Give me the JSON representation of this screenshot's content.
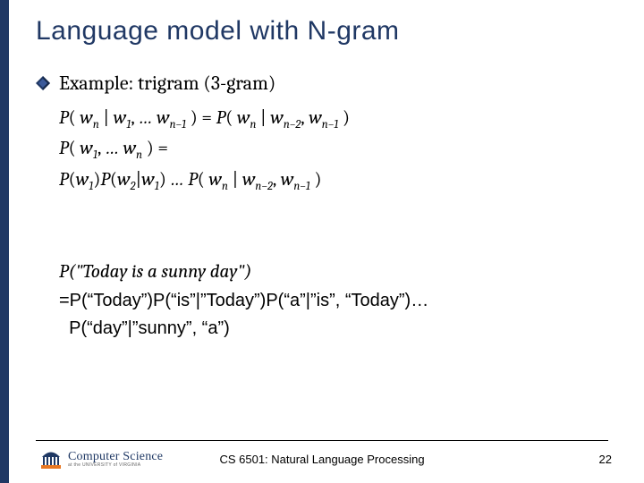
{
  "title": "Language model with N-gram",
  "bullet_icon_name": "diamond-bullet-icon",
  "example_label": "Example: trigram (3-gram)",
  "eq1_lhs": "P( w<sub>n</sub> | w<sub>1</sub>, … w<sub>n−1</sub> )",
  "eq1_rhs": "= P( w<sub>n</sub> | w<sub>n−2</sub>, w<sub>n−1</sub> )",
  "eq2_lhs": "P( w<sub>1</sub>, … w<sub>n</sub> ) =",
  "eq2_expansion": "P(w<sub>1</sub>)P(w<sub>2</sub>|w<sub>1</sub>) … P( w<sub>n</sub> | w<sub>n−2</sub>, w<sub>n−1</sub> )",
  "example_sentence": "P(\"Today is a sunny day\")",
  "example_expansion_l1": "=P(“Today”)P(“is”|”Today”)P(“a”|”is”, “Today”)…",
  "example_expansion_l2": "  P(“day”|”sunny”, “a”)",
  "footer": {
    "course": "CS 6501: Natural Language Processing",
    "page": "22",
    "logo_main": "Computer Science",
    "logo_sub": "at the UNIVERSITY of VIRGINIA"
  },
  "colors": {
    "accent": "#203864"
  }
}
